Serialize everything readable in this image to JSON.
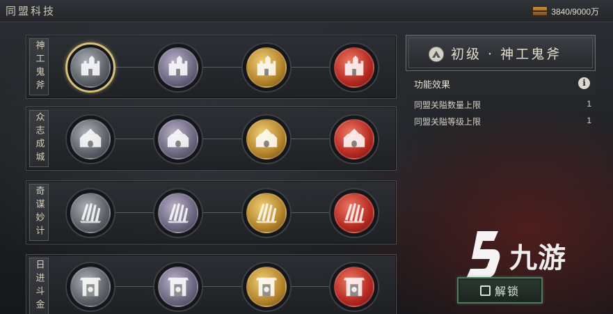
{
  "header": {
    "title": "同盟科技",
    "resource_icon": "treasure-chest-icon",
    "resource_value": "3840/9000万"
  },
  "tech_rows": [
    {
      "label": "神工鬼斧",
      "icon": "fortress-icon"
    },
    {
      "label": "众志成城",
      "icon": "city-gate-icon"
    },
    {
      "label": "奇谋妙计",
      "icon": "scrolls-icon"
    },
    {
      "label": "日进斗金",
      "icon": "coin-gate-icon"
    }
  ],
  "tiers": [
    "steel",
    "violet",
    "gold",
    "red"
  ],
  "tier_colors": {
    "steel": "#7a7e85",
    "violet": "#8a8299",
    "gold": "#c99a3b",
    "red": "#c73a2e"
  },
  "selected": {
    "row": 0,
    "tier": 0
  },
  "panel": {
    "icon": "mountain-icon",
    "title": "初级 · 神工鬼斧",
    "effects_label": "功能效果",
    "effects_info_icon": "i",
    "effects": [
      {
        "name": "同盟关隘数量上限",
        "value": "1"
      },
      {
        "name": "同盟关隘等级上限",
        "value": "1"
      }
    ]
  },
  "unlock_button": {
    "label": "解锁"
  },
  "watermark": {
    "text": "九游"
  }
}
